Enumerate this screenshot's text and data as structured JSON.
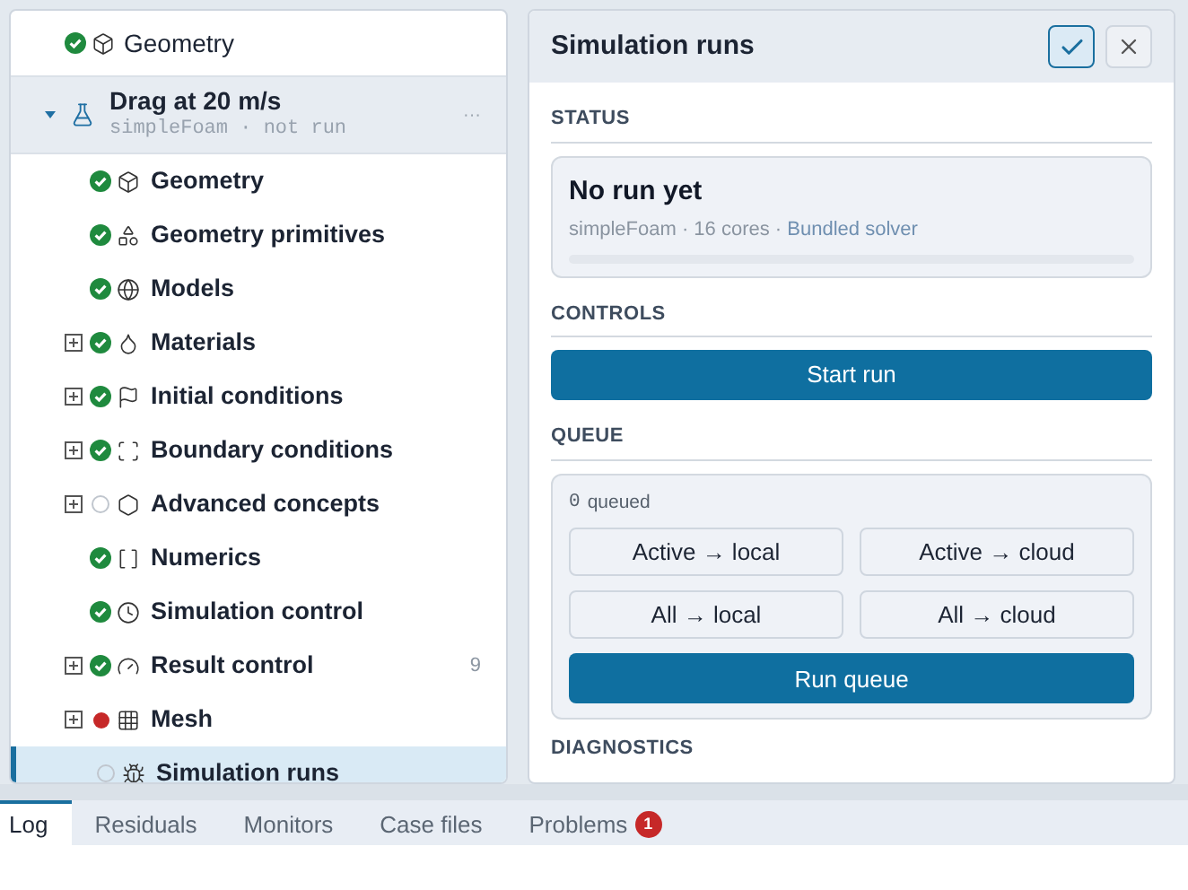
{
  "tree": {
    "top_item": {
      "label": "Geometry",
      "kind": "ok"
    },
    "group": {
      "title": "Drag at 20 m/s",
      "subtitle": "simpleFoam · not run",
      "more": "···",
      "expanded": true,
      "children": [
        {
          "label": "Geometry",
          "kind": "ok",
          "expandable": false,
          "selected": false
        },
        {
          "label": "Geometry primitives",
          "kind": "ok",
          "expandable": false,
          "selected": false
        },
        {
          "label": "Models",
          "kind": "ok",
          "expandable": false,
          "selected": false
        },
        {
          "label": "Materials",
          "kind": "ok",
          "expandable": true,
          "selected": false
        },
        {
          "label": "Initial conditions",
          "kind": "ok",
          "expandable": true,
          "selected": false
        },
        {
          "label": "Boundary conditions",
          "kind": "ok",
          "expandable": true,
          "selected": false
        },
        {
          "label": "Advanced concepts",
          "kind": "none",
          "expandable": true,
          "selected": false
        },
        {
          "label": "Numerics",
          "kind": "ok",
          "expandable": false,
          "selected": false
        },
        {
          "label": "Simulation control",
          "kind": "ok",
          "expandable": false,
          "selected": false
        },
        {
          "label": "Result control",
          "kind": "ok",
          "expandable": true,
          "selected": false,
          "count": "9"
        },
        {
          "label": "Mesh",
          "kind": "error",
          "expandable": true,
          "selected": false
        },
        {
          "label": "Simulation runs",
          "kind": "none",
          "expandable": false,
          "selected": true
        }
      ]
    }
  },
  "panel": {
    "title": "Simulation runs",
    "status": {
      "heading": "STATUS",
      "title": "No run yet",
      "details": "simpleFoam · 16 cores ·",
      "source": "Bundled solver",
      "level": 0
    },
    "controls": {
      "heading": "CONTROLS",
      "button": "Start run"
    },
    "queue": {
      "heading": "QUEUE",
      "count": "0",
      "count_label": "queued",
      "buttons": [
        "Active → local",
        "Active → cloud",
        "All → local",
        "All → cloud"
      ],
      "run_button": "Run queue"
    },
    "next_heading": "DIAGNOSTICS"
  },
  "bottom_tabs": [
    {
      "label": "Log",
      "selected": true
    },
    {
      "label": "Residuals",
      "selected": false
    },
    {
      "label": "Monitors",
      "selected": false
    },
    {
      "label": "Case files",
      "selected": false
    },
    {
      "label": "Problems",
      "selected": false,
      "badge": "1"
    }
  ]
}
